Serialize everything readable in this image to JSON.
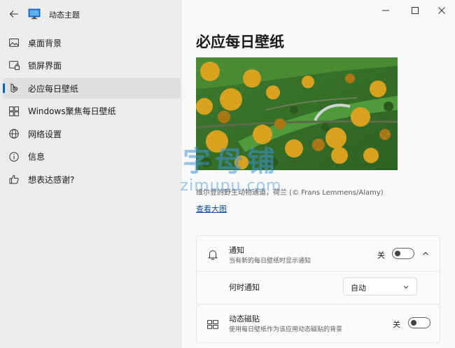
{
  "app": {
    "title": "动态主题"
  },
  "sidebar": {
    "items": [
      {
        "label": "桌面背景",
        "icon": "image-icon"
      },
      {
        "label": "锁屏界面",
        "icon": "lock-screen-icon"
      },
      {
        "label": "必应每日壁纸",
        "icon": "bing-icon",
        "active": true
      },
      {
        "label": "Windows聚焦每日壁纸",
        "icon": "spotlight-grid-icon"
      },
      {
        "label": "网络设置",
        "icon": "globe-icon"
      },
      {
        "label": "信息",
        "icon": "info-icon"
      },
      {
        "label": "想表达感谢?",
        "icon": "thumbs-up-icon"
      }
    ]
  },
  "main": {
    "title": "必应每日壁纸",
    "caption": "维尔登的野生动物通道，荷兰 (© Frans Lemmens/Alamy)",
    "view_link": "查看大图",
    "notification": {
      "title": "通知",
      "subtitle": "当有新的每日壁纸时显示通知",
      "toggle_label": "关",
      "toggle_on": false
    },
    "when_notify": {
      "label": "何时通知",
      "value": "自动"
    },
    "live_tile": {
      "title": "动态磁贴",
      "subtitle": "使用每日壁纸作为该应用动态磁贴的背景",
      "toggle_label": "关",
      "toggle_on": false
    }
  },
  "watermark": {
    "big": "字母铺",
    "small": "zimupu.com"
  },
  "colors": {
    "accent": "#0067c0",
    "link": "#0f4c9c",
    "sidebar_bg": "#ececec",
    "content_bg": "#f9f9f9"
  }
}
